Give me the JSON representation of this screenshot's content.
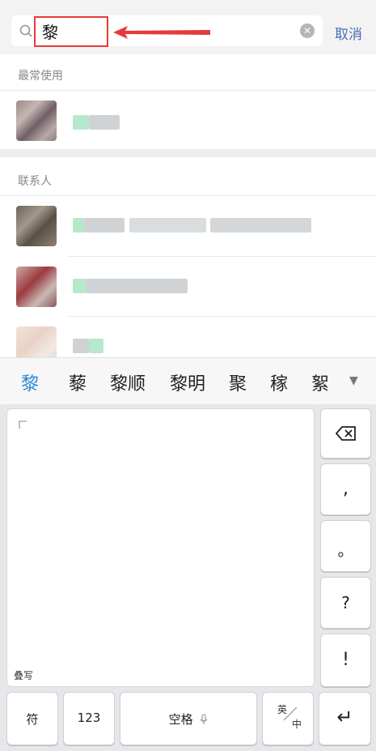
{
  "search": {
    "query": "黎",
    "cancel_label": "取消"
  },
  "sections": {
    "recent_title": "最常使用",
    "contacts_title": "联系人"
  },
  "candidates": {
    "items": [
      "黎",
      "藜",
      "黎顺",
      "黎明",
      "聚",
      "稼",
      "絮"
    ],
    "more_icon": "▼"
  },
  "keyboard": {
    "handwriting_label": "叠写",
    "backspace_icon": "backspace-icon",
    "comma": ",",
    "period": "。",
    "question": "?",
    "exclaim": "!",
    "symbols": "符",
    "numbers": "123",
    "space": "空格",
    "lang_en": "英",
    "lang_zh": "中",
    "enter_icon": "↵"
  },
  "colors": {
    "accent": "#2f86d6",
    "cancel": "#4a6fb5",
    "annotation": "#e63a3a"
  }
}
